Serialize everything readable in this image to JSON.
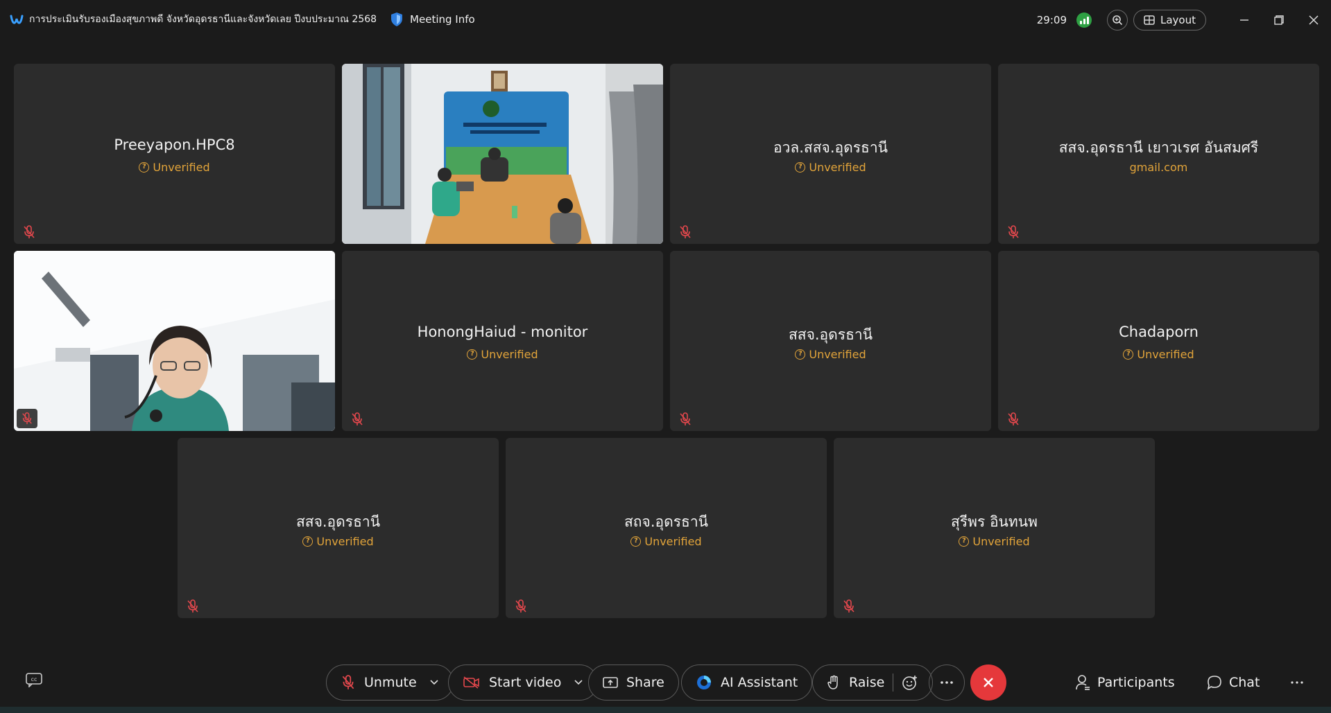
{
  "titlebar": {
    "meeting_title": "การประเมินรับรองเมืองสุขภาพดี จังหวัดอุดรธานีและจังหวัดเลย ปีงบประมาณ 2568",
    "meeting_info_label": "Meeting Info",
    "timer": "29:09",
    "layout_label": "Layout"
  },
  "tiles": [
    {
      "name": "Preeyapon.HPC8",
      "sub": "Unverified"
    },
    {
      "name": "",
      "sub": ""
    },
    {
      "name": "อวล.สสจ.อุดรธานี",
      "sub": "Unverified"
    },
    {
      "name": "สสจ.อุดรธานี เยาวเรศ อันสมศรี",
      "sub": "gmail.com"
    },
    {
      "name": "",
      "sub": ""
    },
    {
      "name": "HonongHaiud - monitor",
      "sub": "Unverified"
    },
    {
      "name": "สสจ.อุดรธานี",
      "sub": "Unverified"
    },
    {
      "name": "Chadaporn",
      "sub": "Unverified"
    },
    {
      "name": "สสจ.อุดรธานี",
      "sub": "Unverified"
    },
    {
      "name": "สถจ.อุดรธานี",
      "sub": "Unverified"
    },
    {
      "name": "สุรีพร อินทนพ",
      "sub": "Unverified"
    }
  ],
  "controls": {
    "unmute": "Unmute",
    "start_video": "Start video",
    "share": "Share",
    "ai_assistant": "AI Assistant",
    "raise": "Raise",
    "participants": "Participants",
    "chat": "Chat"
  },
  "colors": {
    "background": "#1b1b1b",
    "tile": "#2c2c2c",
    "unverified": "#e2a43a",
    "leave": "#e5383b",
    "signal": "#2ea043"
  }
}
